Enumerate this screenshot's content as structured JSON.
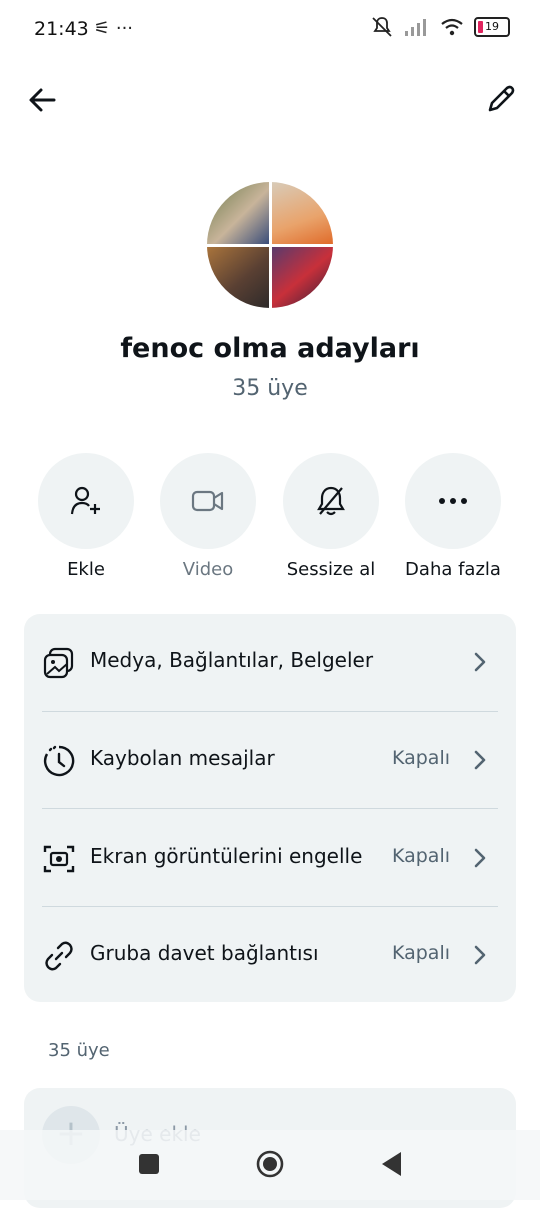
{
  "status_bar": {
    "time": "21:43",
    "left_icons": "⚟ ···",
    "battery": "19"
  },
  "group": {
    "name": "fenoc olma adayları",
    "member_count": "35 üye"
  },
  "actions": [
    {
      "label": "Ekle",
      "icon": "person-add-icon"
    },
    {
      "label": "Video",
      "icon": "video-icon"
    },
    {
      "label": "Sessize al",
      "icon": "bell-mute-icon"
    },
    {
      "label": "Daha fazla",
      "icon": "more-icon"
    }
  ],
  "settings": [
    {
      "title": "Medya, Bağlantılar, Belgeler",
      "value": ""
    },
    {
      "title": "Kaybolan mesajlar",
      "value": "Kapalı"
    },
    {
      "title": "Ekran görüntülerini engelle",
      "value": "Kapalı"
    },
    {
      "title": "Gruba davet bağlantısı",
      "value": "Kapalı"
    }
  ],
  "members": {
    "header": "35 üye",
    "add_label": "Üye ekle"
  },
  "colors": {
    "primary_text": "#0f1419",
    "secondary_text": "#536471",
    "card_bg": "#eff3f4"
  }
}
